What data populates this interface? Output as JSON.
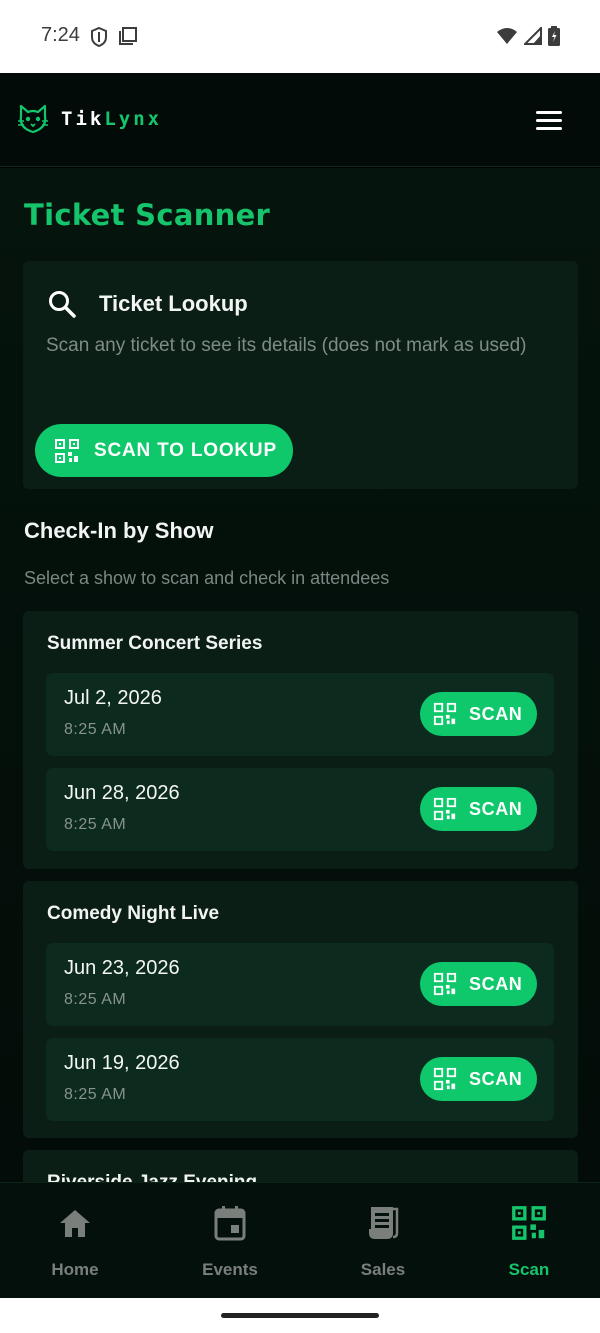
{
  "status_bar": {
    "time": "7:24"
  },
  "header": {
    "brand_prefix": "Tik",
    "brand_suffix": "Lynx"
  },
  "page_title": "Ticket Scanner",
  "lookup": {
    "title": "Ticket Lookup",
    "description": "Scan any ticket to see its details (does not mark as used)",
    "button_label": "SCAN TO LOOKUP"
  },
  "checkin": {
    "title": "Check-In by Show",
    "subtitle": "Select a show to scan and check in attendees"
  },
  "shows": [
    {
      "name": "Summer Concert Series",
      "dates": [
        {
          "date": "Jul 2, 2026",
          "time": "8:25 AM",
          "button": "SCAN"
        },
        {
          "date": "Jun 28, 2026",
          "time": "8:25 AM",
          "button": "SCAN"
        }
      ]
    },
    {
      "name": "Comedy Night Live",
      "dates": [
        {
          "date": "Jun 23, 2026",
          "time": "8:25 AM",
          "button": "SCAN"
        },
        {
          "date": "Jun 19, 2026",
          "time": "8:25 AM",
          "button": "SCAN"
        }
      ]
    },
    {
      "name": "Riverside Jazz Evening",
      "dates": []
    }
  ],
  "nav": [
    {
      "label": "Home",
      "icon": "home-icon",
      "active": false
    },
    {
      "label": "Events",
      "icon": "calendar-icon",
      "active": false
    },
    {
      "label": "Sales",
      "icon": "receipt-icon",
      "active": false
    },
    {
      "label": "Scan",
      "icon": "qr-scan-icon",
      "active": true
    }
  ],
  "colors": {
    "accent": "#15c46b",
    "button": "#0fc86b",
    "background": "#05140d",
    "card": "#0b1e16",
    "row": "#0d2a1e"
  }
}
